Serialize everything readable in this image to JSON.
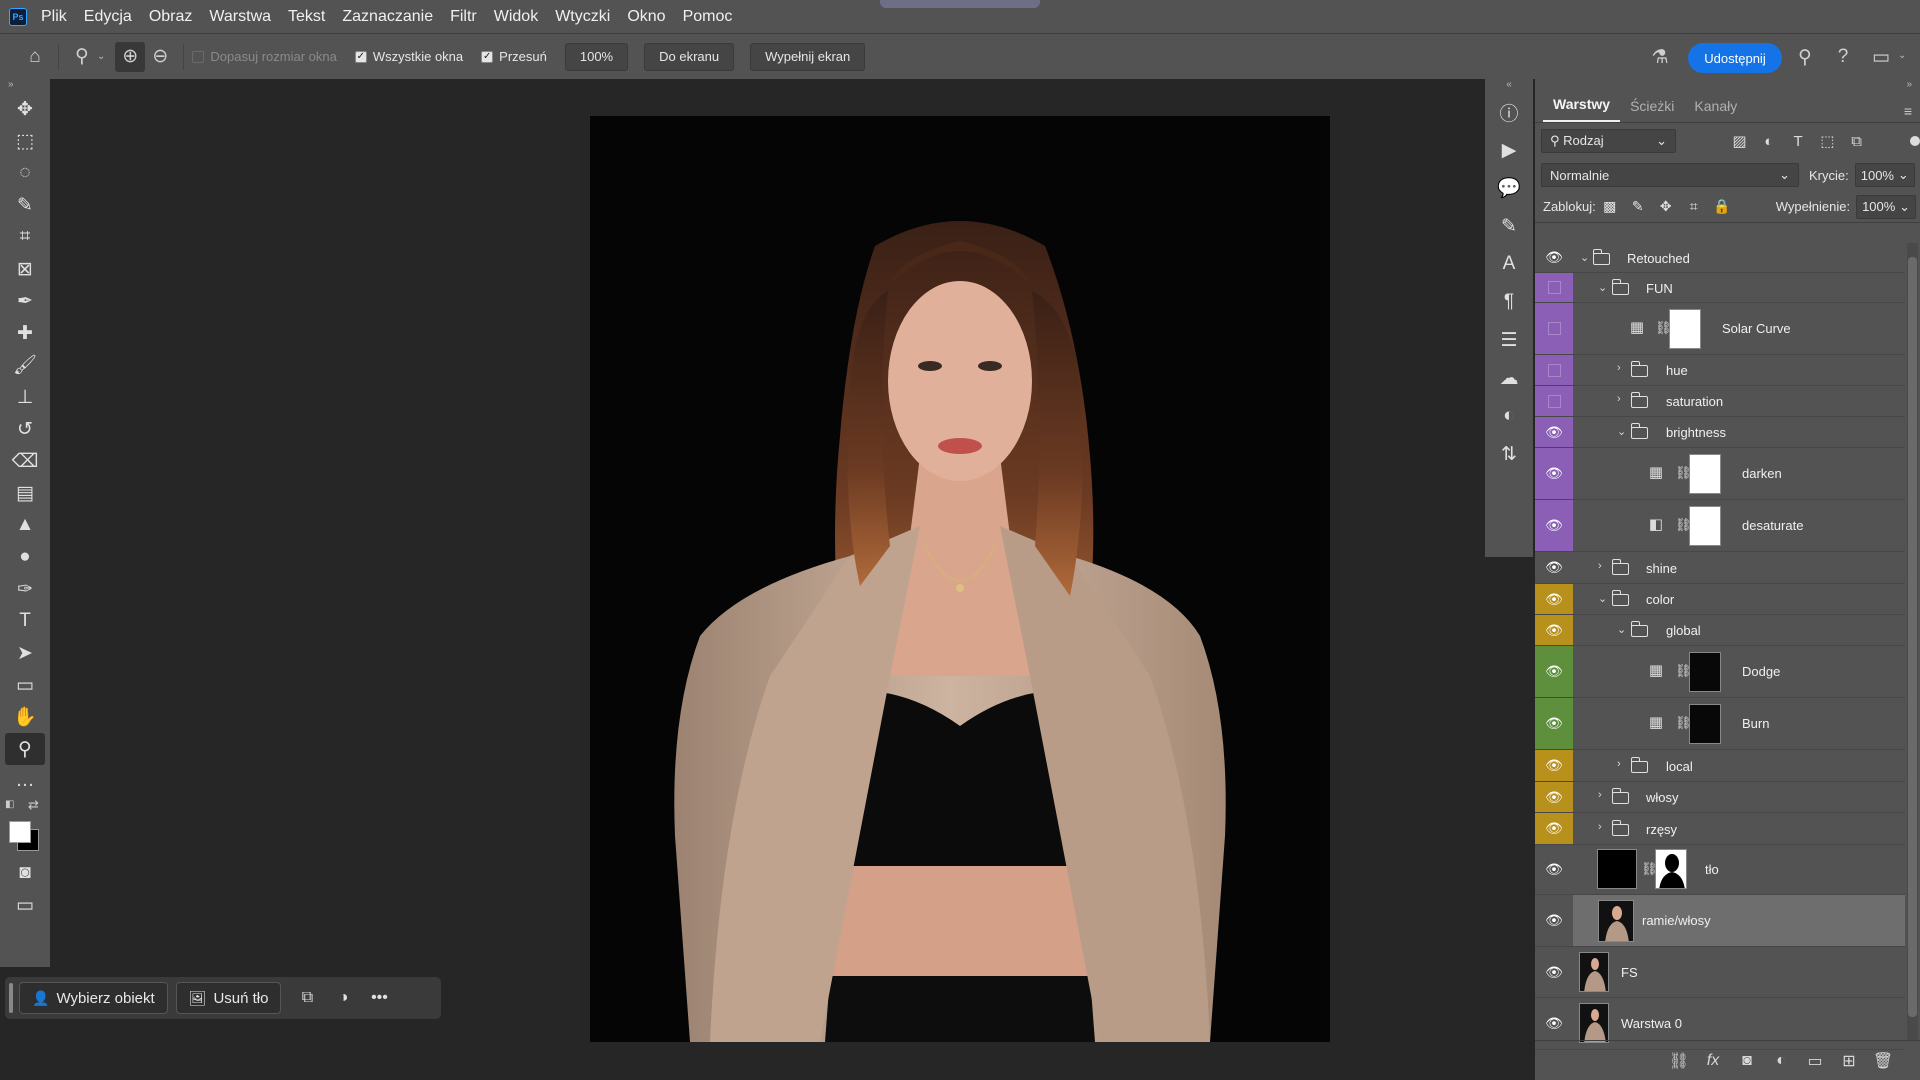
{
  "app": {
    "logo": "Ps"
  },
  "menu": [
    "Plik",
    "Edycja",
    "Obraz",
    "Warstwa",
    "Tekst",
    "Zaznaczanie",
    "Filtr",
    "Widok",
    "Wtyczki",
    "Okno",
    "Pomoc"
  ],
  "options": {
    "fit_window_label": "Dopasuj rozmiar okna",
    "all_windows_label": "Wszystkie okna",
    "scrubby_label": "Przesuń",
    "zoom_value": "100%",
    "fit_screen_label": "Do ekranu",
    "fill_screen_label": "Wypełnij ekran",
    "share_label": "Udostępnij"
  },
  "taskbar": {
    "select_subject": "Wybierz obiekt",
    "remove_bg": "Usuń tło"
  },
  "layers_panel": {
    "tabs": [
      "Warstwy",
      "Ścieżki",
      "Kanały"
    ],
    "filter_kind": "Rodzaj",
    "blend_mode": "Normalnie",
    "opacity_label": "Krycie:",
    "opacity_value": "100%",
    "lock_label": "Zablokuj:",
    "fill_label": "Wypełnienie:",
    "fill_value": "100%",
    "colors": {
      "purple": "#8a5fb5",
      "yellow": "#b8901c",
      "green": "#5e8f3c"
    }
  },
  "layers": [
    {
      "name": "Retouched"
    },
    {
      "name": "FUN"
    },
    {
      "name": "Solar Curve"
    },
    {
      "name": "hue"
    },
    {
      "name": "saturation"
    },
    {
      "name": "brightness"
    },
    {
      "name": "darken"
    },
    {
      "name": "desaturate"
    },
    {
      "name": "shine"
    },
    {
      "name": "color"
    },
    {
      "name": "global"
    },
    {
      "name": "Dodge"
    },
    {
      "name": "Burn"
    },
    {
      "name": "local"
    },
    {
      "name": "włosy"
    },
    {
      "name": "rzęsy"
    },
    {
      "name": "tło"
    },
    {
      "name": "ramie/włosy"
    },
    {
      "name": "FS"
    },
    {
      "name": "Warstwa 0"
    }
  ]
}
